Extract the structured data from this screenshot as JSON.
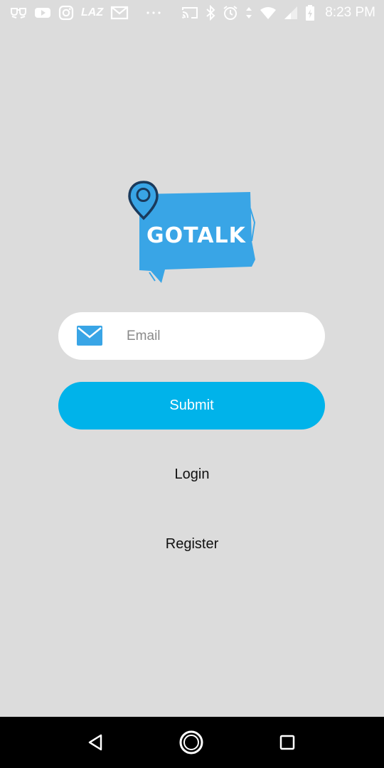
{
  "status_bar": {
    "time": "8:23 PM",
    "lazada_label": "LAZ"
  },
  "logo": {
    "text": "GOTALK",
    "colors": {
      "bubble": "#39a5e6",
      "pin_outline": "#1a3a5c",
      "text": "#ffffff"
    }
  },
  "form": {
    "email_placeholder": "Email",
    "email_value": "",
    "submit_label": "Submit"
  },
  "links": {
    "login_label": "Login",
    "register_label": "Register"
  },
  "colors": {
    "background": "#dcdcdc",
    "accent": "#00b3ea",
    "mail_icon": "#39a5e6"
  }
}
